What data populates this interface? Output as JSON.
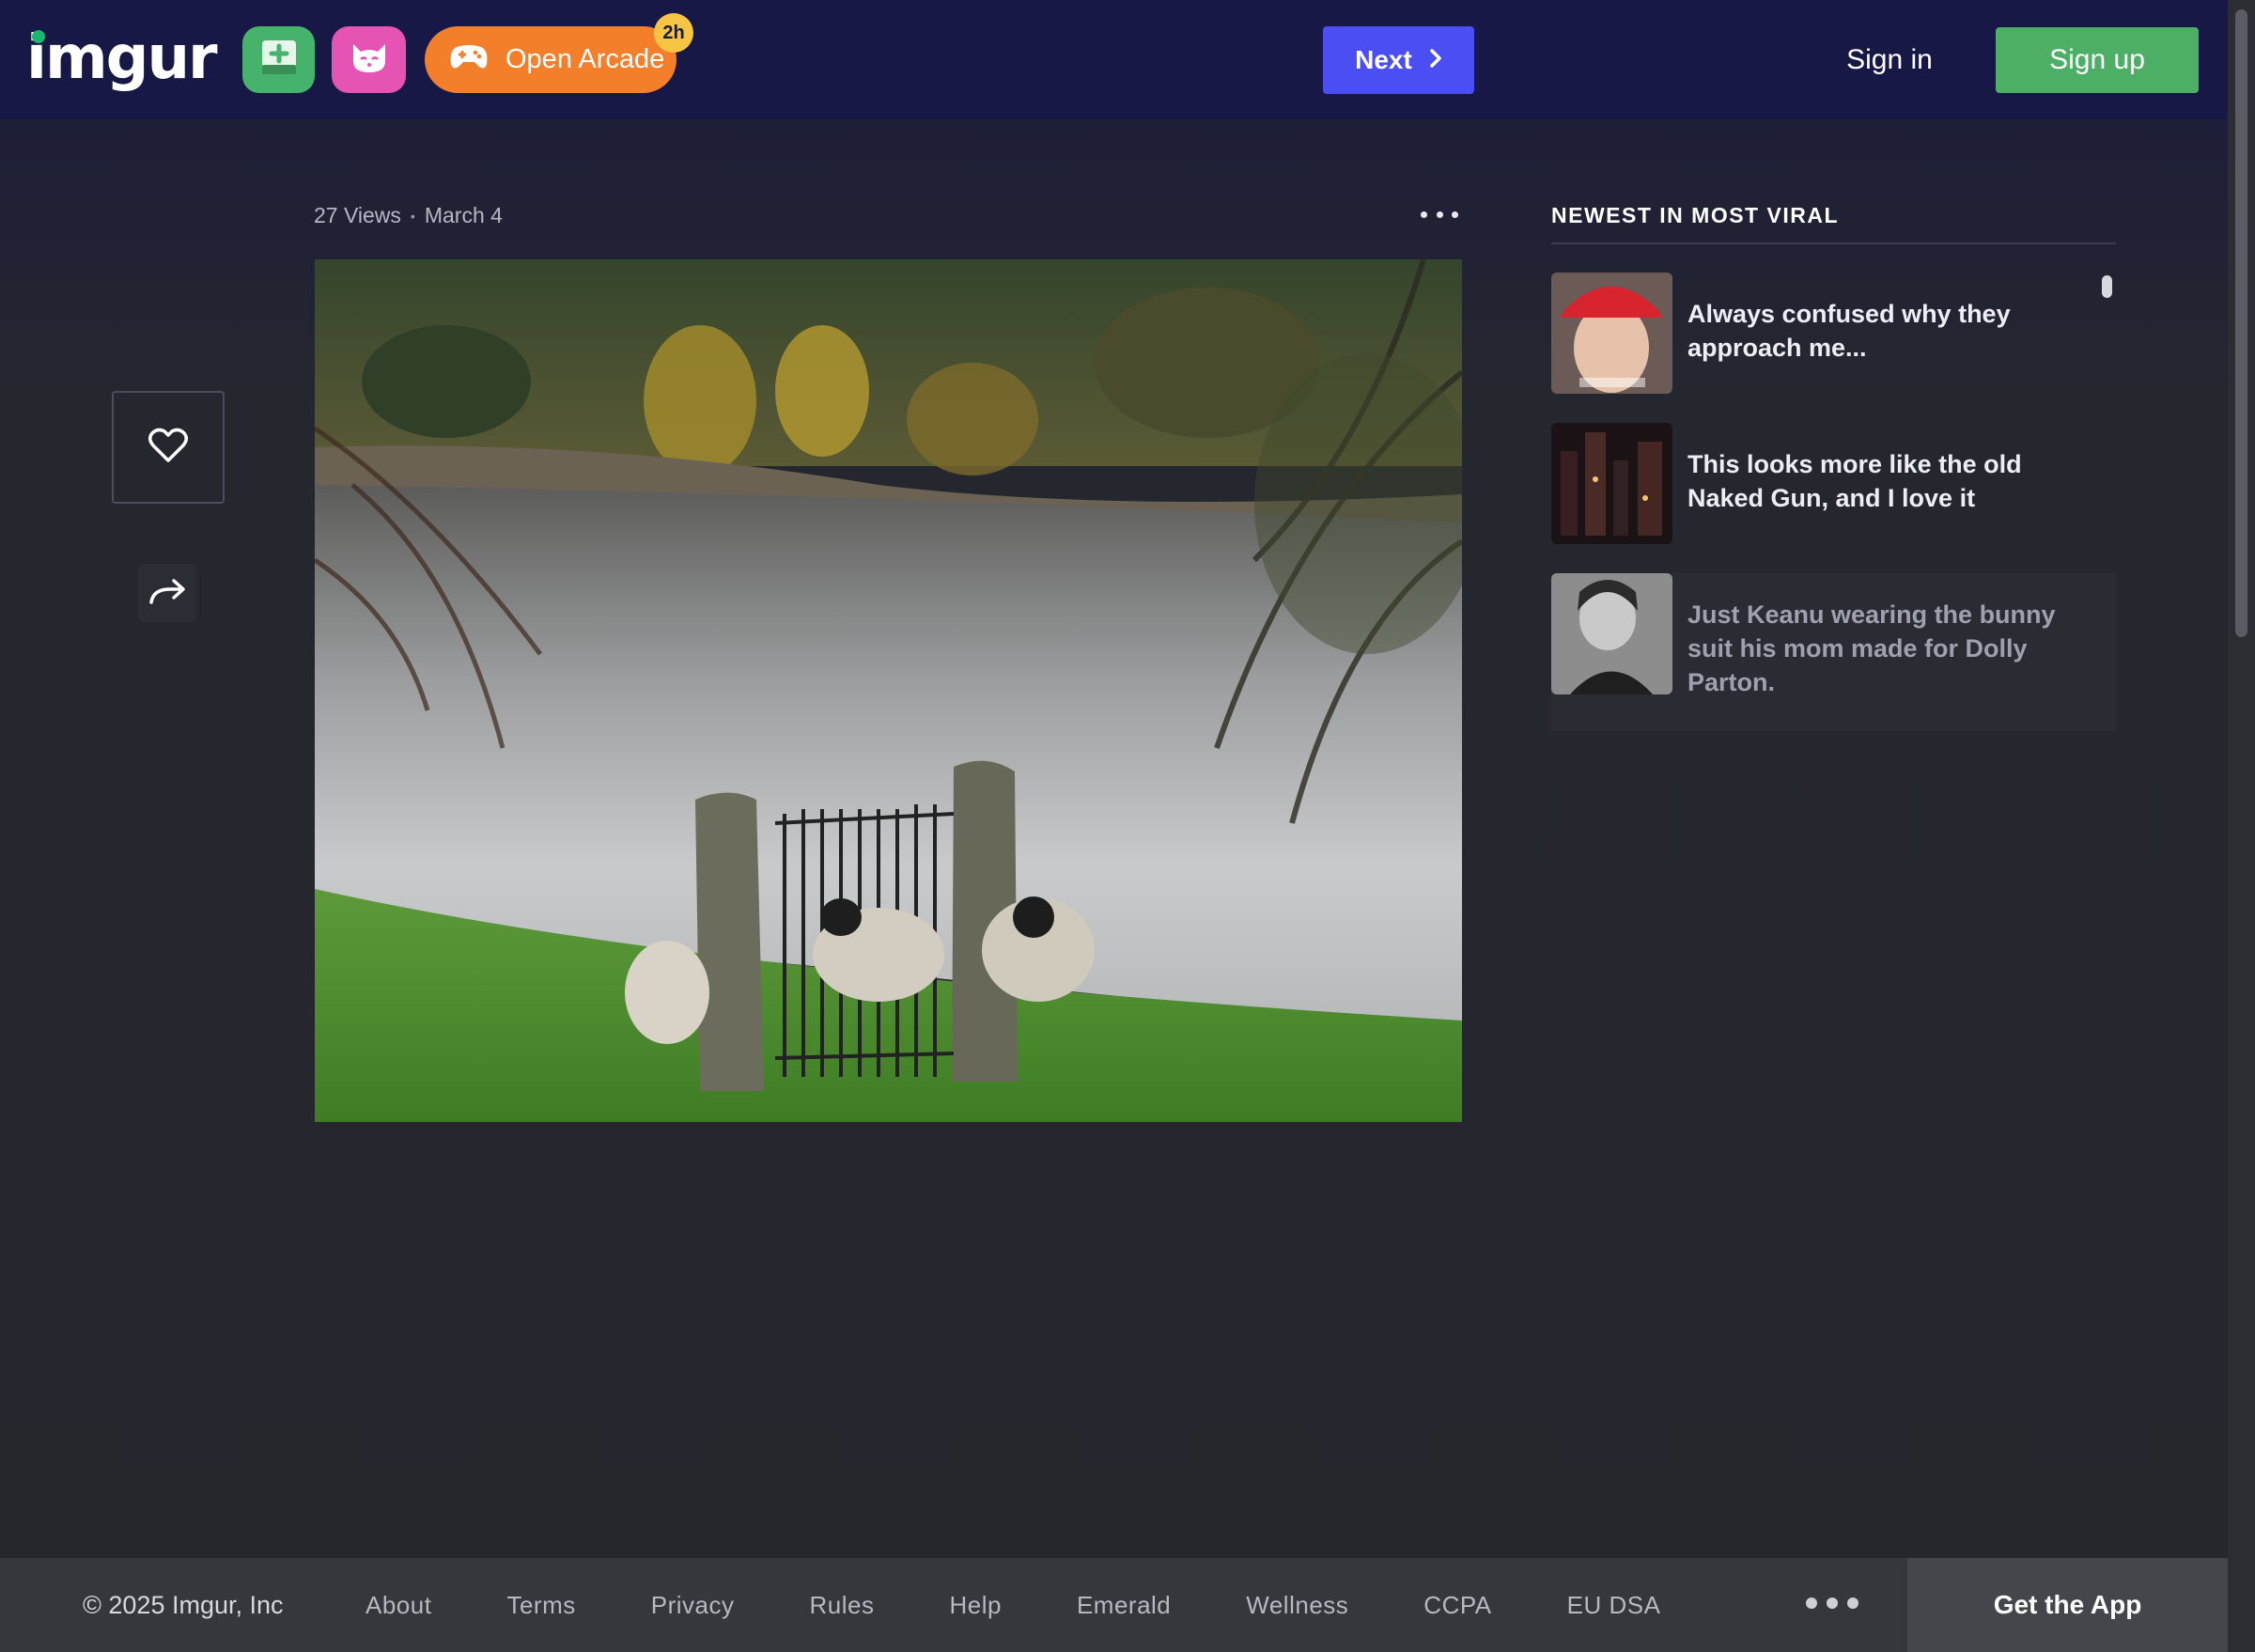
{
  "header": {
    "logo_text": "imgur",
    "arcade_label": "Open Arcade",
    "arcade_badge": "2h",
    "next_label": "Next",
    "signin_label": "Sign in",
    "signup_label": "Sign up"
  },
  "post": {
    "views": "27 Views",
    "date": "March 4"
  },
  "sidebar": {
    "title": "NEWEST IN MOST VIRAL",
    "items": [
      {
        "title": "Always confused why they approach me..."
      },
      {
        "title": "This looks more like the old Naked Gun, and I love it"
      },
      {
        "title": "Just Keanu wearing the bunny suit his mom made for Dolly Parton."
      }
    ]
  },
  "footer": {
    "copyright": "© 2025 Imgur, Inc",
    "links": [
      "About",
      "Terms",
      "Privacy",
      "Rules",
      "Help",
      "Emerald",
      "Wellness",
      "CCPA",
      "EU DSA"
    ],
    "get_app": "Get the App"
  },
  "colors": {
    "header_bg": "#171845",
    "next_button": "#4b4ef2",
    "signup_button": "#4caf65",
    "upload_button": "#46b36d",
    "cat_button": "#e553b4",
    "arcade_button": "#f47f2b"
  },
  "icons": [
    "upload-icon",
    "cat-icon",
    "gamepad-icon",
    "chevron-right-icon",
    "more-icon",
    "heart-icon",
    "share-icon"
  ]
}
